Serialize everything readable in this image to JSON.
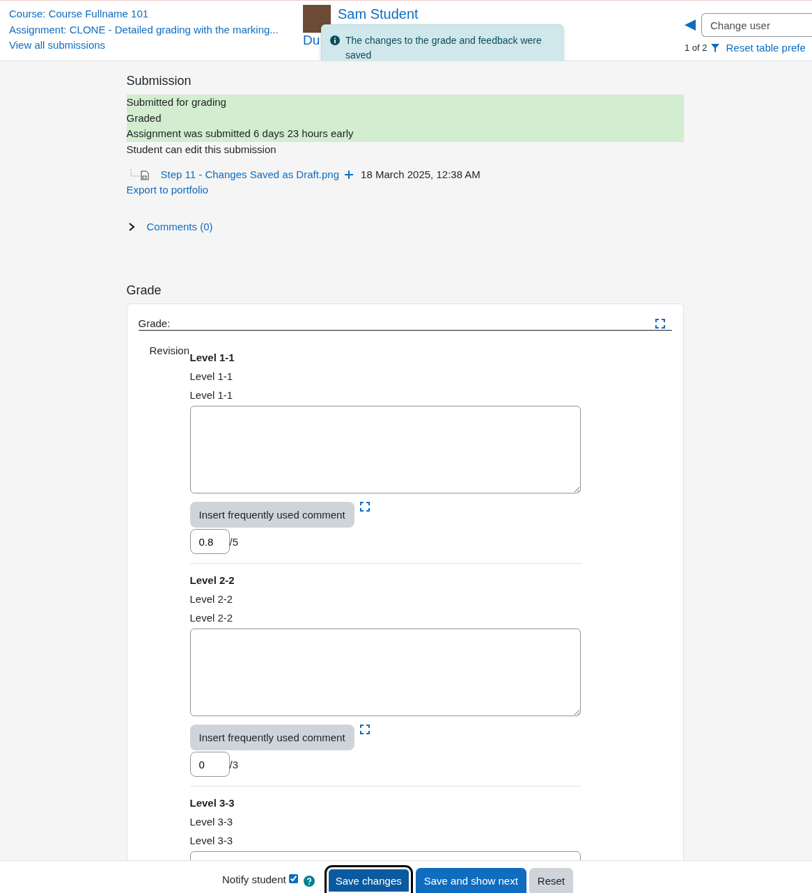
{
  "header": {
    "links": [
      "Course: Course Fullname 101",
      "Assignment: CLONE - Detailed grading with the marking...",
      "View all submissions"
    ],
    "student": {
      "name": "Sam Student",
      "due": "Du"
    },
    "toast": "The changes to the grade and feedback were saved",
    "change_user": {
      "placeholder": "Change user"
    },
    "pager": "1 of 2",
    "reset_link": "Reset table prefe"
  },
  "submission": {
    "title": "Submission",
    "status_lines": [
      "Submitted for grading",
      "Graded",
      "Assignment was submitted 6 days 23 hours early"
    ],
    "note": "Student can edit this submission",
    "file": {
      "name": "Step 11 - Changes Saved as Draft.png",
      "date": "18 March 2025, 12:38 AM"
    },
    "export_link": "Export to portfolio",
    "comments": {
      "label": "Comments (0)",
      "expanded": false
    }
  },
  "grade": {
    "title": "Grade",
    "label": "Grade:",
    "guide_name": "Revision",
    "criteria": [
      {
        "name": "Level 1-1",
        "description": "Level 1-1",
        "remark": "Level 1-1",
        "comment_button": "Insert frequently used comment",
        "score": "0.8",
        "max": "/5"
      },
      {
        "name": "Level 2-2",
        "description": "Level 2-2",
        "remark": "Level 2-2",
        "comment_button": "Insert frequently used comment",
        "score": "0",
        "max": "/3"
      },
      {
        "name": "Level 3-3",
        "description": "Level 3-3",
        "remark": "Level 3-3"
      }
    ]
  },
  "footer": {
    "notify": {
      "label": "Notify student",
      "checked": true
    },
    "buttons": [
      {
        "label": "Save changes",
        "kind": "primary",
        "focused": true
      },
      {
        "label": "Save and show next",
        "kind": "primary",
        "focused": false
      },
      {
        "label": "Reset",
        "kind": "secondary",
        "focused": false
      }
    ]
  }
}
